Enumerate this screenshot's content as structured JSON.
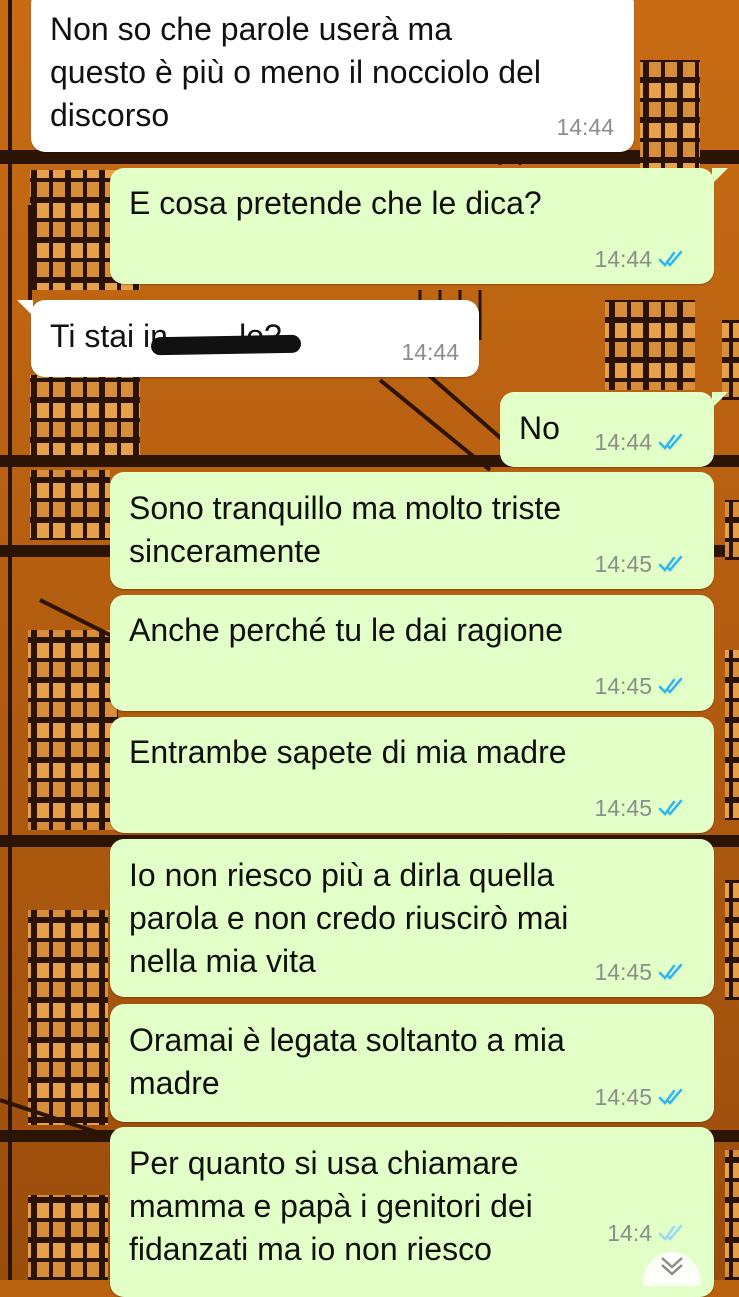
{
  "chat": {
    "messages": [
      {
        "id": "m1",
        "direction": "in",
        "text": "Non so che parole userà ma\nquesto è più o meno il nocciolo del\ndiscorso",
        "time": "14:44"
      },
      {
        "id": "m2",
        "direction": "out",
        "text": "E cosa pretende che le dica?",
        "time": "14:44",
        "status": "read"
      },
      {
        "id": "m3",
        "direction": "in",
        "text": "Ti stai in        lo?",
        "time": "14:44"
      },
      {
        "id": "m4",
        "direction": "out",
        "text": "No",
        "time": "14:44",
        "status": "read"
      },
      {
        "id": "m5",
        "direction": "out",
        "text": "Sono tranquillo ma molto triste\nsinceramente",
        "time": "14:45",
        "status": "read"
      },
      {
        "id": "m6",
        "direction": "out",
        "text": "Anche perché tu le dai ragione",
        "time": "14:45",
        "status": "read"
      },
      {
        "id": "m7",
        "direction": "out",
        "text": "Entrambe sapete di mia madre",
        "time": "14:45",
        "status": "read"
      },
      {
        "id": "m8",
        "direction": "out",
        "text": "Io non riesco più a dirla quella\nparola e non credo riuscirò mai\nnella mia vita",
        "time": "14:45",
        "status": "read"
      },
      {
        "id": "m9",
        "direction": "out",
        "text": "Oramai è legata soltanto a mia\nmadre",
        "time": "14:45",
        "status": "read"
      },
      {
        "id": "m10",
        "direction": "out",
        "text": "Per quanto si usa chiamare\nmamma e papà i genitori dei\nfidanzati ma io non riesco",
        "time": "14:4",
        "status": "read"
      }
    ]
  },
  "colors": {
    "incoming_bubble": "#ffffff",
    "outgoing_bubble": "#e2ffc7",
    "read_tick": "#34b7f1",
    "wallpaper": "#b8620f"
  },
  "icons": {
    "read_receipt": "double-check-icon",
    "scroll_down": "chevron-down-icon"
  }
}
